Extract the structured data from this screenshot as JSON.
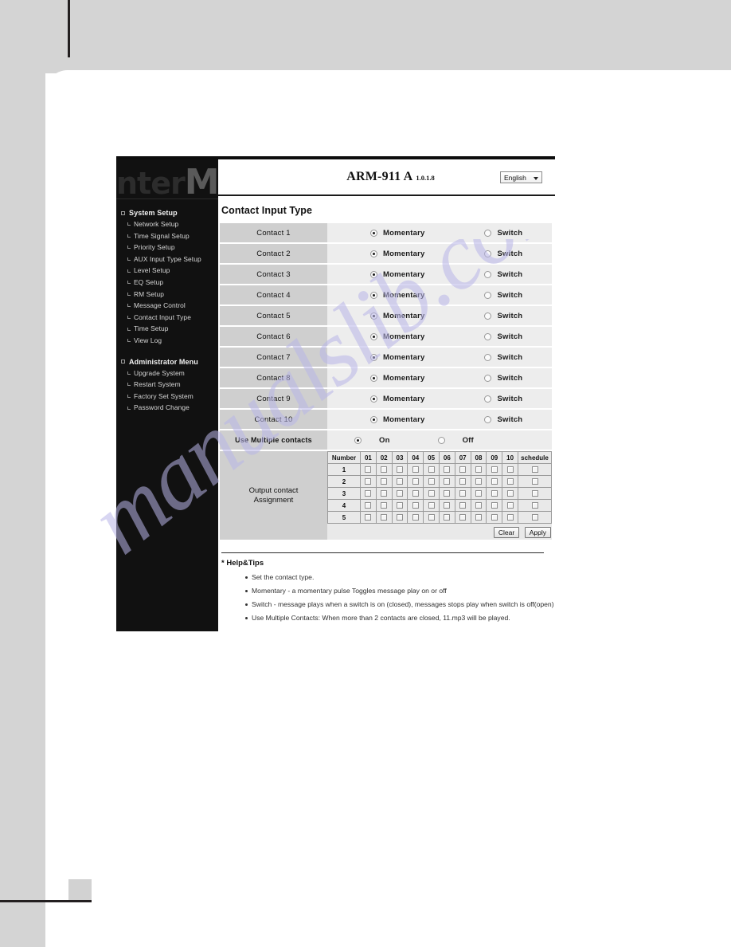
{
  "app": {
    "header": {
      "model": "ARM-911 A",
      "version": "1.0.1.8",
      "language": "English"
    },
    "logo": {
      "text_a": "nter",
      "text_m": "M"
    },
    "page_title": "Contact Input Type"
  },
  "sidebar": {
    "groups": [
      {
        "title": "System Setup",
        "items": [
          {
            "label": "Network Setup"
          },
          {
            "label": "Time Signal Setup"
          },
          {
            "label": "Priority Setup"
          },
          {
            "label": "AUX Input Type Setup"
          },
          {
            "label": "Level Setup"
          },
          {
            "label": "EQ Setup"
          },
          {
            "label": "RM Setup"
          },
          {
            "label": "Message Control"
          },
          {
            "label": "Contact Input Type"
          },
          {
            "label": "Time Setup"
          },
          {
            "label": "View Log"
          }
        ]
      },
      {
        "title": "Administrator Menu",
        "items": [
          {
            "label": "Upgrade System"
          },
          {
            "label": "Restart System"
          },
          {
            "label": "Factory Set System"
          },
          {
            "label": "Password Change"
          }
        ]
      }
    ]
  },
  "settings": {
    "option_labels": {
      "momentary": "Momentary",
      "switch": "Switch"
    },
    "contacts": [
      {
        "label": "Contact 1",
        "selected": "momentary"
      },
      {
        "label": "Contact 2",
        "selected": "momentary"
      },
      {
        "label": "Contact 3",
        "selected": "momentary"
      },
      {
        "label": "Contact 4",
        "selected": "momentary"
      },
      {
        "label": "Contact 5",
        "selected": "momentary"
      },
      {
        "label": "Contact 6",
        "selected": "momentary"
      },
      {
        "label": "Contact 7",
        "selected": "momentary"
      },
      {
        "label": "Contact 8",
        "selected": "momentary"
      },
      {
        "label": "Contact 9",
        "selected": "momentary"
      },
      {
        "label": "Contact 10",
        "selected": "momentary"
      }
    ],
    "multiple_contacts": {
      "label": "Use Multiple contacts",
      "on_label": "On",
      "off_label": "Off",
      "selected": "on"
    },
    "assignment": {
      "label_line1": "Output contact",
      "label_line2": "Assignment",
      "columns": [
        "Number",
        "01",
        "02",
        "03",
        "04",
        "05",
        "06",
        "07",
        "08",
        "09",
        "10",
        "schedule"
      ],
      "rows": [
        {
          "number": "1",
          "checks": [
            false,
            false,
            false,
            false,
            false,
            false,
            false,
            false,
            false,
            false
          ],
          "schedule": false
        },
        {
          "number": "2",
          "checks": [
            false,
            false,
            false,
            false,
            false,
            false,
            false,
            false,
            false,
            false
          ],
          "schedule": false
        },
        {
          "number": "3",
          "checks": [
            false,
            false,
            false,
            false,
            false,
            false,
            false,
            false,
            false,
            false
          ],
          "schedule": false
        },
        {
          "number": "4",
          "checks": [
            false,
            false,
            false,
            false,
            false,
            false,
            false,
            false,
            false,
            false
          ],
          "schedule": false
        },
        {
          "number": "5",
          "checks": [
            false,
            false,
            false,
            false,
            false,
            false,
            false,
            false,
            false,
            false
          ],
          "schedule": false
        }
      ],
      "clear_label": "Clear",
      "apply_label": "Apply"
    }
  },
  "help": {
    "title": "* Help&Tips",
    "items": [
      "Set the contact type.",
      "Momentary - a momentary pulse Toggles message play on or off",
      "Switch - message plays when a switch is on (closed), messages stops play when switch is off(open)",
      "Use Multiple Contacts: When more than 2 contacts are closed, 11.mp3 will be played."
    ]
  },
  "watermark": {
    "text": "manualslib.com"
  }
}
